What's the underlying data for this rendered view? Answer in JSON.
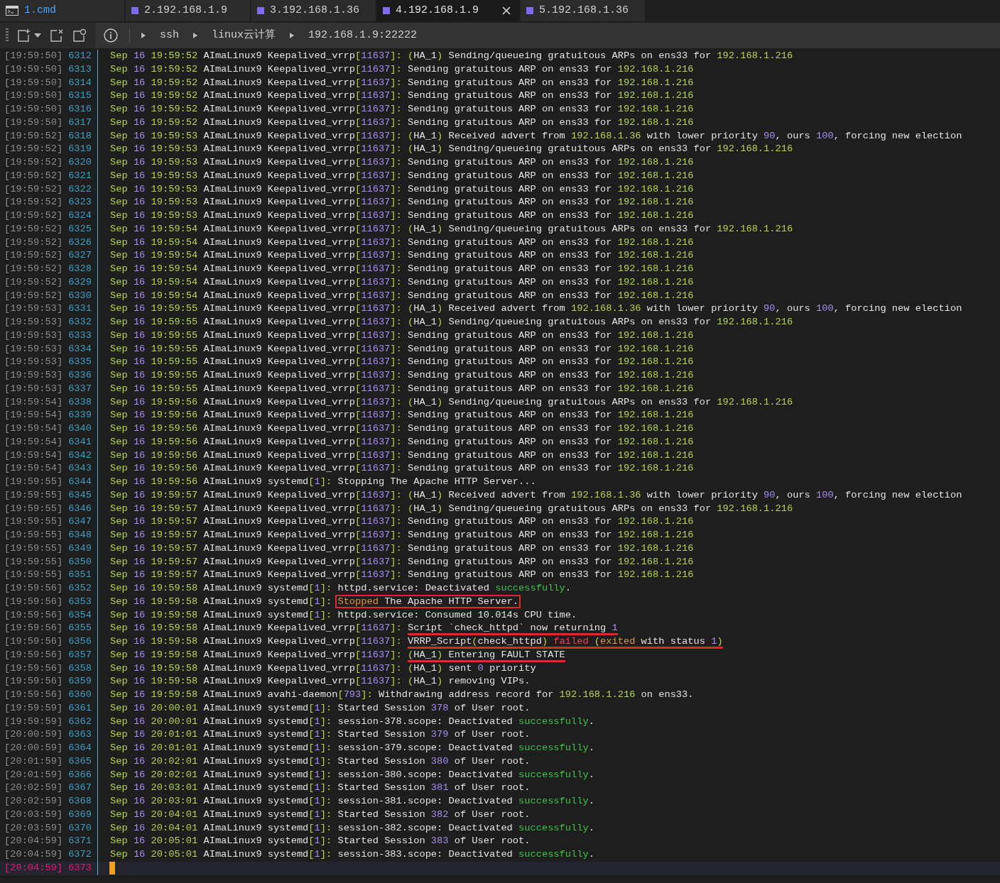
{
  "tabs": [
    {
      "label": "1.cmd",
      "kind": "cmd",
      "selected": false
    },
    {
      "label": "2.192.168.1.9",
      "kind": "ssh",
      "selected": false
    },
    {
      "label": "3.192.168.1.36",
      "kind": "ssh",
      "selected": false
    },
    {
      "label": "4.192.168.1.9",
      "kind": "ssh",
      "selected": true
    },
    {
      "label": "5.192.168.1.36",
      "kind": "ssh",
      "selected": false
    }
  ],
  "breadcrumb": [
    "ssh",
    "linux云计算",
    "192.168.1.9:22222"
  ],
  "lines": [
    {
      "time": "[19:59:50]",
      "num": "6312",
      "kind": "log",
      "month": "Sep",
      "day": "16",
      "clock": "19:59:52",
      "host": "AImaLinux9",
      "proc": "Keepalived_vrrp",
      "pid": "[11637]:",
      "msg": [
        {
          "text": "(",
          "kind": "accent"
        },
        {
          "text": "HA_1",
          "kind": "plain"
        },
        {
          "text": ")",
          "kind": "accent"
        },
        {
          "text": " Sending/queueing gratuitous ARPs on ens33 for ",
          "kind": "plain"
        },
        {
          "text": "192.168.1.216",
          "kind": "accent"
        }
      ]
    },
    {
      "time": "[19:59:50]",
      "num": "6313",
      "kind": "log",
      "month": "Sep",
      "day": "16",
      "clock": "19:59:52",
      "host": "AImaLinux9",
      "proc": "Keepalived_vrrp",
      "pid": "[11637]:",
      "msg": [
        {
          "text": "Sending gratuitous ARP on ens33 for ",
          "kind": "plain"
        },
        {
          "text": "192.168.1.216",
          "kind": "accent"
        }
      ]
    },
    {
      "time": "[19:59:50]",
      "num": "6314",
      "kind": "log",
      "month": "Sep",
      "day": "16",
      "clock": "19:59:52",
      "host": "AImaLinux9",
      "proc": "Keepalived_vrrp",
      "pid": "[11637]:",
      "msg": [
        {
          "text": "Sending gratuitous ARP on ens33 for ",
          "kind": "plain"
        },
        {
          "text": "192.168.1.216",
          "kind": "accent"
        }
      ]
    },
    {
      "time": "[19:59:50]",
      "num": "6315",
      "kind": "log",
      "month": "Sep",
      "day": "16",
      "clock": "19:59:52",
      "host": "AImaLinux9",
      "proc": "Keepalived_vrrp",
      "pid": "[11637]:",
      "msg": [
        {
          "text": "Sending gratuitous ARP on ens33 for ",
          "kind": "plain"
        },
        {
          "text": "192.168.1.216",
          "kind": "accent"
        }
      ]
    },
    {
      "time": "[19:59:50]",
      "num": "6316",
      "kind": "log",
      "month": "Sep",
      "day": "16",
      "clock": "19:59:52",
      "host": "AImaLinux9",
      "proc": "Keepalived_vrrp",
      "pid": "[11637]:",
      "msg": [
        {
          "text": "Sending gratuitous ARP on ens33 for ",
          "kind": "plain"
        },
        {
          "text": "192.168.1.216",
          "kind": "accent"
        }
      ]
    },
    {
      "time": "[19:59:50]",
      "num": "6317",
      "kind": "log",
      "month": "Sep",
      "day": "16",
      "clock": "19:59:52",
      "host": "AImaLinux9",
      "proc": "Keepalived_vrrp",
      "pid": "[11637]:",
      "msg": [
        {
          "text": "Sending gratuitous ARP on ens33 for ",
          "kind": "plain"
        },
        {
          "text": "192.168.1.216",
          "kind": "accent"
        }
      ]
    },
    {
      "time": "[19:59:52]",
      "num": "6318",
      "kind": "log",
      "month": "Sep",
      "day": "16",
      "clock": "19:59:53",
      "host": "AImaLinux9",
      "proc": "Keepalived_vrrp",
      "pid": "[11637]:",
      "msg": [
        {
          "text": "(",
          "kind": "accent"
        },
        {
          "text": "HA_1",
          "kind": "plain"
        },
        {
          "text": ")",
          "kind": "accent"
        },
        {
          "text": " Received advert from ",
          "kind": "plain"
        },
        {
          "text": "192.168.1.36",
          "kind": "accent"
        },
        {
          "text": " with lower priority ",
          "kind": "plain"
        },
        {
          "text": "90",
          "kind": "number"
        },
        {
          "text": ", ours ",
          "kind": "plain"
        },
        {
          "text": "100",
          "kind": "number"
        },
        {
          "text": ", forcing new election",
          "kind": "plain"
        }
      ]
    },
    {
      "time": "[19:59:52]",
      "num": "6319",
      "kind": "log",
      "month": "Sep",
      "day": "16",
      "clock": "19:59:53",
      "host": "AImaLinux9",
      "proc": "Keepalived_vrrp",
      "pid": "[11637]:",
      "msg": [
        {
          "text": "(",
          "kind": "accent"
        },
        {
          "text": "HA_1",
          "kind": "plain"
        },
        {
          "text": ")",
          "kind": "accent"
        },
        {
          "text": " Sending/queueing gratuitous ARPs on ens33 for ",
          "kind": "plain"
        },
        {
          "text": "192.168.1.216",
          "kind": "accent"
        }
      ]
    },
    {
      "time": "[19:59:52]",
      "num": "6320",
      "kind": "log",
      "month": "Sep",
      "day": "16",
      "clock": "19:59:53",
      "host": "AImaLinux9",
      "proc": "Keepalived_vrrp",
      "pid": "[11637]:",
      "msg": [
        {
          "text": "Sending gratuitous ARP on ens33 for ",
          "kind": "plain"
        },
        {
          "text": "192.168.1.216",
          "kind": "accent"
        }
      ]
    },
    {
      "time": "[19:59:52]",
      "num": "6321",
      "kind": "log",
      "month": "Sep",
      "day": "16",
      "clock": "19:59:53",
      "host": "AImaLinux9",
      "proc": "Keepalived_vrrp",
      "pid": "[11637]:",
      "msg": [
        {
          "text": "Sending gratuitous ARP on ens33 for ",
          "kind": "plain"
        },
        {
          "text": "192.168.1.216",
          "kind": "accent"
        }
      ]
    },
    {
      "time": "[19:59:52]",
      "num": "6322",
      "kind": "log",
      "month": "Sep",
      "day": "16",
      "clock": "19:59:53",
      "host": "AImaLinux9",
      "proc": "Keepalived_vrrp",
      "pid": "[11637]:",
      "msg": [
        {
          "text": "Sending gratuitous ARP on ens33 for ",
          "kind": "plain"
        },
        {
          "text": "192.168.1.216",
          "kind": "accent"
        }
      ]
    },
    {
      "time": "[19:59:52]",
      "num": "6323",
      "kind": "log",
      "month": "Sep",
      "day": "16",
      "clock": "19:59:53",
      "host": "AImaLinux9",
      "proc": "Keepalived_vrrp",
      "pid": "[11637]:",
      "msg": [
        {
          "text": "Sending gratuitous ARP on ens33 for ",
          "kind": "plain"
        },
        {
          "text": "192.168.1.216",
          "kind": "accent"
        }
      ]
    },
    {
      "time": "[19:59:52]",
      "num": "6324",
      "kind": "log",
      "month": "Sep",
      "day": "16",
      "clock": "19:59:53",
      "host": "AImaLinux9",
      "proc": "Keepalived_vrrp",
      "pid": "[11637]:",
      "msg": [
        {
          "text": "Sending gratuitous ARP on ens33 for ",
          "kind": "plain"
        },
        {
          "text": "192.168.1.216",
          "kind": "accent"
        }
      ]
    },
    {
      "time": "[19:59:52]",
      "num": "6325",
      "kind": "log",
      "month": "Sep",
      "day": "16",
      "clock": "19:59:54",
      "host": "AImaLinux9",
      "proc": "Keepalived_vrrp",
      "pid": "[11637]:",
      "msg": [
        {
          "text": "(",
          "kind": "accent"
        },
        {
          "text": "HA_1",
          "kind": "plain"
        },
        {
          "text": ")",
          "kind": "accent"
        },
        {
          "text": " Sending/queueing gratuitous ARPs on ens33 for ",
          "kind": "plain"
        },
        {
          "text": "192.168.1.216",
          "kind": "accent"
        }
      ]
    },
    {
      "time": "[19:59:52]",
      "num": "6326",
      "kind": "log",
      "month": "Sep",
      "day": "16",
      "clock": "19:59:54",
      "host": "AImaLinux9",
      "proc": "Keepalived_vrrp",
      "pid": "[11637]:",
      "msg": [
        {
          "text": "Sending gratuitous ARP on ens33 for ",
          "kind": "plain"
        },
        {
          "text": "192.168.1.216",
          "kind": "accent"
        }
      ]
    },
    {
      "time": "[19:59:52]",
      "num": "6327",
      "kind": "log",
      "month": "Sep",
      "day": "16",
      "clock": "19:59:54",
      "host": "AImaLinux9",
      "proc": "Keepalived_vrrp",
      "pid": "[11637]:",
      "msg": [
        {
          "text": "Sending gratuitous ARP on ens33 for ",
          "kind": "plain"
        },
        {
          "text": "192.168.1.216",
          "kind": "accent"
        }
      ]
    },
    {
      "time": "[19:59:52]",
      "num": "6328",
      "kind": "log",
      "month": "Sep",
      "day": "16",
      "clock": "19:59:54",
      "host": "AImaLinux9",
      "proc": "Keepalived_vrrp",
      "pid": "[11637]:",
      "msg": [
        {
          "text": "Sending gratuitous ARP on ens33 for ",
          "kind": "plain"
        },
        {
          "text": "192.168.1.216",
          "kind": "accent"
        }
      ]
    },
    {
      "time": "[19:59:52]",
      "num": "6329",
      "kind": "log",
      "month": "Sep",
      "day": "16",
      "clock": "19:59:54",
      "host": "AImaLinux9",
      "proc": "Keepalived_vrrp",
      "pid": "[11637]:",
      "msg": [
        {
          "text": "Sending gratuitous ARP on ens33 for ",
          "kind": "plain"
        },
        {
          "text": "192.168.1.216",
          "kind": "accent"
        }
      ]
    },
    {
      "time": "[19:59:52]",
      "num": "6330",
      "kind": "log",
      "month": "Sep",
      "day": "16",
      "clock": "19:59:54",
      "host": "AImaLinux9",
      "proc": "Keepalived_vrrp",
      "pid": "[11637]:",
      "msg": [
        {
          "text": "Sending gratuitous ARP on ens33 for ",
          "kind": "plain"
        },
        {
          "text": "192.168.1.216",
          "kind": "accent"
        }
      ]
    },
    {
      "time": "[19:59:53]",
      "num": "6331",
      "kind": "log",
      "month": "Sep",
      "day": "16",
      "clock": "19:59:55",
      "host": "AImaLinux9",
      "proc": "Keepalived_vrrp",
      "pid": "[11637]:",
      "msg": [
        {
          "text": "(",
          "kind": "accent"
        },
        {
          "text": "HA_1",
          "kind": "plain"
        },
        {
          "text": ")",
          "kind": "accent"
        },
        {
          "text": " Received advert from ",
          "kind": "plain"
        },
        {
          "text": "192.168.1.36",
          "kind": "accent"
        },
        {
          "text": " with lower priority ",
          "kind": "plain"
        },
        {
          "text": "90",
          "kind": "number"
        },
        {
          "text": ", ours ",
          "kind": "plain"
        },
        {
          "text": "100",
          "kind": "number"
        },
        {
          "text": ", forcing new election",
          "kind": "plain"
        }
      ]
    },
    {
      "time": "[19:59:53]",
      "num": "6332",
      "kind": "log",
      "month": "Sep",
      "day": "16",
      "clock": "19:59:55",
      "host": "AImaLinux9",
      "proc": "Keepalived_vrrp",
      "pid": "[11637]:",
      "msg": [
        {
          "text": "(",
          "kind": "accent"
        },
        {
          "text": "HA_1",
          "kind": "plain"
        },
        {
          "text": ")",
          "kind": "accent"
        },
        {
          "text": " Sending/queueing gratuitous ARPs on ens33 for ",
          "kind": "plain"
        },
        {
          "text": "192.168.1.216",
          "kind": "accent"
        }
      ]
    },
    {
      "time": "[19:59:53]",
      "num": "6333",
      "kind": "log",
      "month": "Sep",
      "day": "16",
      "clock": "19:59:55",
      "host": "AImaLinux9",
      "proc": "Keepalived_vrrp",
      "pid": "[11637]:",
      "msg": [
        {
          "text": "Sending gratuitous ARP on ens33 for ",
          "kind": "plain"
        },
        {
          "text": "192.168.1.216",
          "kind": "accent"
        }
      ]
    },
    {
      "time": "[19:59:53]",
      "num": "6334",
      "kind": "log",
      "month": "Sep",
      "day": "16",
      "clock": "19:59:55",
      "host": "AImaLinux9",
      "proc": "Keepalived_vrrp",
      "pid": "[11637]:",
      "msg": [
        {
          "text": "Sending gratuitous ARP on ens33 for ",
          "kind": "plain"
        },
        {
          "text": "192.168.1.216",
          "kind": "accent"
        }
      ]
    },
    {
      "time": "[19:59:53]",
      "num": "6335",
      "kind": "log",
      "month": "Sep",
      "day": "16",
      "clock": "19:59:55",
      "host": "AImaLinux9",
      "proc": "Keepalived_vrrp",
      "pid": "[11637]:",
      "msg": [
        {
          "text": "Sending gratuitous ARP on ens33 for ",
          "kind": "plain"
        },
        {
          "text": "192.168.1.216",
          "kind": "accent"
        }
      ]
    },
    {
      "time": "[19:59:53]",
      "num": "6336",
      "kind": "log",
      "month": "Sep",
      "day": "16",
      "clock": "19:59:55",
      "host": "AImaLinux9",
      "proc": "Keepalived_vrrp",
      "pid": "[11637]:",
      "msg": [
        {
          "text": "Sending gratuitous ARP on ens33 for ",
          "kind": "plain"
        },
        {
          "text": "192.168.1.216",
          "kind": "accent"
        }
      ]
    },
    {
      "time": "[19:59:53]",
      "num": "6337",
      "kind": "log",
      "month": "Sep",
      "day": "16",
      "clock": "19:59:55",
      "host": "AImaLinux9",
      "proc": "Keepalived_vrrp",
      "pid": "[11637]:",
      "msg": [
        {
          "text": "Sending gratuitous ARP on ens33 for ",
          "kind": "plain"
        },
        {
          "text": "192.168.1.216",
          "kind": "accent"
        }
      ]
    },
    {
      "time": "[19:59:54]",
      "num": "6338",
      "kind": "log",
      "month": "Sep",
      "day": "16",
      "clock": "19:59:56",
      "host": "AImaLinux9",
      "proc": "Keepalived_vrrp",
      "pid": "[11637]:",
      "msg": [
        {
          "text": "(",
          "kind": "accent"
        },
        {
          "text": "HA_1",
          "kind": "plain"
        },
        {
          "text": ")",
          "kind": "accent"
        },
        {
          "text": " Sending/queueing gratuitous ARPs on ens33 for ",
          "kind": "plain"
        },
        {
          "text": "192.168.1.216",
          "kind": "accent"
        }
      ]
    },
    {
      "time": "[19:59:54]",
      "num": "6339",
      "kind": "log",
      "month": "Sep",
      "day": "16",
      "clock": "19:59:56",
      "host": "AImaLinux9",
      "proc": "Keepalived_vrrp",
      "pid": "[11637]:",
      "msg": [
        {
          "text": "Sending gratuitous ARP on ens33 for ",
          "kind": "plain"
        },
        {
          "text": "192.168.1.216",
          "kind": "accent"
        }
      ]
    },
    {
      "time": "[19:59:54]",
      "num": "6340",
      "kind": "log",
      "month": "Sep",
      "day": "16",
      "clock": "19:59:56",
      "host": "AImaLinux9",
      "proc": "Keepalived_vrrp",
      "pid": "[11637]:",
      "msg": [
        {
          "text": "Sending gratuitous ARP on ens33 for ",
          "kind": "plain"
        },
        {
          "text": "192.168.1.216",
          "kind": "accent"
        }
      ]
    },
    {
      "time": "[19:59:54]",
      "num": "6341",
      "kind": "log",
      "month": "Sep",
      "day": "16",
      "clock": "19:59:56",
      "host": "AImaLinux9",
      "proc": "Keepalived_vrrp",
      "pid": "[11637]:",
      "msg": [
        {
          "text": "Sending gratuitous ARP on ens33 for ",
          "kind": "plain"
        },
        {
          "text": "192.168.1.216",
          "kind": "accent"
        }
      ]
    },
    {
      "time": "[19:59:54]",
      "num": "6342",
      "kind": "log",
      "month": "Sep",
      "day": "16",
      "clock": "19:59:56",
      "host": "AImaLinux9",
      "proc": "Keepalived_vrrp",
      "pid": "[11637]:",
      "msg": [
        {
          "text": "Sending gratuitous ARP on ens33 for ",
          "kind": "plain"
        },
        {
          "text": "192.168.1.216",
          "kind": "accent"
        }
      ]
    },
    {
      "time": "[19:59:54]",
      "num": "6343",
      "kind": "log",
      "month": "Sep",
      "day": "16",
      "clock": "19:59:56",
      "host": "AImaLinux9",
      "proc": "Keepalived_vrrp",
      "pid": "[11637]:",
      "msg": [
        {
          "text": "Sending gratuitous ARP on ens33 for ",
          "kind": "plain"
        },
        {
          "text": "192.168.1.216",
          "kind": "accent"
        }
      ]
    },
    {
      "time": "[19:59:55]",
      "num": "6344",
      "kind": "log",
      "month": "Sep",
      "day": "16",
      "clock": "19:59:56",
      "host": "AImaLinux9",
      "proc": "systemd",
      "pid": "[1]:",
      "msg": [
        {
          "text": "Stopping The Apache HTTP Server...",
          "kind": "plain"
        }
      ]
    },
    {
      "time": "[19:59:55]",
      "num": "6345",
      "kind": "log",
      "month": "Sep",
      "day": "16",
      "clock": "19:59:57",
      "host": "AImaLinux9",
      "proc": "Keepalived_vrrp",
      "pid": "[11637]:",
      "msg": [
        {
          "text": "(",
          "kind": "accent"
        },
        {
          "text": "HA_1",
          "kind": "plain"
        },
        {
          "text": ")",
          "kind": "accent"
        },
        {
          "text": " Received advert from ",
          "kind": "plain"
        },
        {
          "text": "192.168.1.36",
          "kind": "accent"
        },
        {
          "text": " with lower priority ",
          "kind": "plain"
        },
        {
          "text": "90",
          "kind": "number"
        },
        {
          "text": ", ours ",
          "kind": "plain"
        },
        {
          "text": "100",
          "kind": "number"
        },
        {
          "text": ", forcing new election",
          "kind": "plain"
        }
      ]
    },
    {
      "time": "[19:59:55]",
      "num": "6346",
      "kind": "log",
      "month": "Sep",
      "day": "16",
      "clock": "19:59:57",
      "host": "AImaLinux9",
      "proc": "Keepalived_vrrp",
      "pid": "[11637]:",
      "msg": [
        {
          "text": "(",
          "kind": "accent"
        },
        {
          "text": "HA_1",
          "kind": "plain"
        },
        {
          "text": ")",
          "kind": "accent"
        },
        {
          "text": " Sending/queueing gratuitous ARPs on ens33 for ",
          "kind": "plain"
        },
        {
          "text": "192.168.1.216",
          "kind": "accent"
        }
      ]
    },
    {
      "time": "[19:59:55]",
      "num": "6347",
      "kind": "log",
      "month": "Sep",
      "day": "16",
      "clock": "19:59:57",
      "host": "AImaLinux9",
      "proc": "Keepalived_vrrp",
      "pid": "[11637]:",
      "msg": [
        {
          "text": "Sending gratuitous ARP on ens33 for ",
          "kind": "plain"
        },
        {
          "text": "192.168.1.216",
          "kind": "accent"
        }
      ]
    },
    {
      "time": "[19:59:55]",
      "num": "6348",
      "kind": "log",
      "month": "Sep",
      "day": "16",
      "clock": "19:59:57",
      "host": "AImaLinux9",
      "proc": "Keepalived_vrrp",
      "pid": "[11637]:",
      "msg": [
        {
          "text": "Sending gratuitous ARP on ens33 for ",
          "kind": "plain"
        },
        {
          "text": "192.168.1.216",
          "kind": "accent"
        }
      ]
    },
    {
      "time": "[19:59:55]",
      "num": "6349",
      "kind": "log",
      "month": "Sep",
      "day": "16",
      "clock": "19:59:57",
      "host": "AImaLinux9",
      "proc": "Keepalived_vrrp",
      "pid": "[11637]:",
      "msg": [
        {
          "text": "Sending gratuitous ARP on ens33 for ",
          "kind": "plain"
        },
        {
          "text": "192.168.1.216",
          "kind": "accent"
        }
      ]
    },
    {
      "time": "[19:59:55]",
      "num": "6350",
      "kind": "log",
      "month": "Sep",
      "day": "16",
      "clock": "19:59:57",
      "host": "AImaLinux9",
      "proc": "Keepalived_vrrp",
      "pid": "[11637]:",
      "msg": [
        {
          "text": "Sending gratuitous ARP on ens33 for ",
          "kind": "plain"
        },
        {
          "text": "192.168.1.216",
          "kind": "accent"
        }
      ]
    },
    {
      "time": "[19:59:55]",
      "num": "6351",
      "kind": "log",
      "month": "Sep",
      "day": "16",
      "clock": "19:59:57",
      "host": "AImaLinux9",
      "proc": "Keepalived_vrrp",
      "pid": "[11637]:",
      "msg": [
        {
          "text": "Sending gratuitous ARP on ens33 for ",
          "kind": "plain"
        },
        {
          "text": "192.168.1.216",
          "kind": "accent"
        }
      ]
    },
    {
      "time": "[19:59:56]",
      "num": "6352",
      "kind": "log",
      "month": "Sep",
      "day": "16",
      "clock": "19:59:58",
      "host": "AImaLinux9",
      "proc": "systemd",
      "pid": "[1]:",
      "msg": [
        {
          "text": "httpd.service: Deactivated ",
          "kind": "plain"
        },
        {
          "text": "successfully",
          "kind": "success"
        },
        {
          "text": ".",
          "kind": "plain"
        }
      ]
    },
    {
      "time": "[19:59:56]",
      "num": "6353",
      "kind": "log",
      "month": "Sep",
      "day": "16",
      "clock": "19:59:58",
      "host": "AImaLinux9",
      "proc": "systemd",
      "pid": "[1]:",
      "boxed": true,
      "msg": [
        {
          "text": "Stopped",
          "kind": "warning"
        },
        {
          "text": " The Apache HTTP Server.",
          "kind": "plain"
        }
      ]
    },
    {
      "time": "[19:59:56]",
      "num": "6354",
      "kind": "log",
      "month": "Sep",
      "day": "16",
      "clock": "19:59:58",
      "host": "AImaLinux9",
      "proc": "systemd",
      "pid": "[1]:",
      "msg": [
        {
          "text": "httpd.service: Consumed 10.014s CPU time.",
          "kind": "plain"
        }
      ]
    },
    {
      "time": "[19:59:56]",
      "num": "6355",
      "kind": "log",
      "month": "Sep",
      "day": "16",
      "clock": "19:59:58",
      "host": "AImaLinux9",
      "proc": "Keepalived_vrrp",
      "pid": "[11637]:",
      "underlined": true,
      "msg": [
        {
          "text": "Script `check_httpd` now returning ",
          "kind": "plain"
        },
        {
          "text": "1",
          "kind": "number"
        }
      ]
    },
    {
      "time": "[19:59:56]",
      "num": "6356",
      "kind": "log",
      "month": "Sep",
      "day": "16",
      "clock": "19:59:58",
      "host": "AImaLinux9",
      "proc": "Keepalived_vrrp",
      "pid": "[11637]:",
      "underlined": true,
      "msg": [
        {
          "text": "VRRP_Script",
          "kind": "plain"
        },
        {
          "text": "(",
          "kind": "accent"
        },
        {
          "text": "check_httpd",
          "kind": "plain"
        },
        {
          "text": ")",
          "kind": "accent"
        },
        {
          "text": " failed",
          "kind": "error"
        },
        {
          "text": " (",
          "kind": "accent"
        },
        {
          "text": "exited",
          "kind": "warning"
        },
        {
          "text": " with status ",
          "kind": "plain"
        },
        {
          "text": "1",
          "kind": "number"
        },
        {
          "text": ")",
          "kind": "accent"
        }
      ]
    },
    {
      "time": "[19:59:56]",
      "num": "6357",
      "kind": "log",
      "month": "Sep",
      "day": "16",
      "clock": "19:59:58",
      "host": "AImaLinux9",
      "proc": "Keepalived_vrrp",
      "pid": "[11637]:",
      "underlined": true,
      "msg": [
        {
          "text": "(",
          "kind": "accent"
        },
        {
          "text": "HA_1",
          "kind": "plain"
        },
        {
          "text": ")",
          "kind": "accent"
        },
        {
          "text": " Entering FAULT STATE",
          "kind": "plain"
        }
      ]
    },
    {
      "time": "[19:59:56]",
      "num": "6358",
      "kind": "log",
      "month": "Sep",
      "day": "16",
      "clock": "19:59:58",
      "host": "AImaLinux9",
      "proc": "Keepalived_vrrp",
      "pid": "[11637]:",
      "msg": [
        {
          "text": "(",
          "kind": "accent"
        },
        {
          "text": "HA_1",
          "kind": "plain"
        },
        {
          "text": ")",
          "kind": "accent"
        },
        {
          "text": " sent ",
          "kind": "plain"
        },
        {
          "text": "0",
          "kind": "number"
        },
        {
          "text": " priority",
          "kind": "plain"
        }
      ]
    },
    {
      "time": "[19:59:56]",
      "num": "6359",
      "kind": "log",
      "month": "Sep",
      "day": "16",
      "clock": "19:59:58",
      "host": "AImaLinux9",
      "proc": "Keepalived_vrrp",
      "pid": "[11637]:",
      "msg": [
        {
          "text": "(",
          "kind": "accent"
        },
        {
          "text": "HA_1",
          "kind": "plain"
        },
        {
          "text": ")",
          "kind": "accent"
        },
        {
          "text": " removing VIPs.",
          "kind": "plain"
        }
      ]
    },
    {
      "time": "[19:59:56]",
      "num": "6360",
      "kind": "log",
      "month": "Sep",
      "day": "16",
      "clock": "19:59:58",
      "host": "AImaLinux9",
      "proc": "avahi-daemon",
      "pid": "[793]:",
      "msg": [
        {
          "text": "Withdrawing address record for ",
          "kind": "plain"
        },
        {
          "text": "192.168.1.216",
          "kind": "accent"
        },
        {
          "text": " on ens33.",
          "kind": "plain"
        }
      ]
    },
    {
      "time": "[19:59:59]",
      "num": "6361",
      "kind": "log",
      "month": "Sep",
      "day": "16",
      "clock": "20:00:01",
      "host": "AImaLinux9",
      "proc": "systemd",
      "pid": "[1]:",
      "msg": [
        {
          "text": "Started Session ",
          "kind": "plain"
        },
        {
          "text": "378",
          "kind": "number"
        },
        {
          "text": " of User root.",
          "kind": "plain"
        }
      ]
    },
    {
      "time": "[19:59:59]",
      "num": "6362",
      "kind": "log",
      "month": "Sep",
      "day": "16",
      "clock": "20:00:01",
      "host": "AImaLinux9",
      "proc": "systemd",
      "pid": "[1]:",
      "msg": [
        {
          "text": "session-378.scope: Deactivated ",
          "kind": "plain"
        },
        {
          "text": "successfully",
          "kind": "success"
        },
        {
          "text": ".",
          "kind": "plain"
        }
      ]
    },
    {
      "time": "[20:00:59]",
      "num": "6363",
      "kind": "log",
      "month": "Sep",
      "day": "16",
      "clock": "20:01:01",
      "host": "AImaLinux9",
      "proc": "systemd",
      "pid": "[1]:",
      "msg": [
        {
          "text": "Started Session ",
          "kind": "plain"
        },
        {
          "text": "379",
          "kind": "number"
        },
        {
          "text": " of User root.",
          "kind": "plain"
        }
      ]
    },
    {
      "time": "[20:00:59]",
      "num": "6364",
      "kind": "log",
      "month": "Sep",
      "day": "16",
      "clock": "20:01:01",
      "host": "AImaLinux9",
      "proc": "systemd",
      "pid": "[1]:",
      "msg": [
        {
          "text": "session-379.scope: Deactivated ",
          "kind": "plain"
        },
        {
          "text": "successfully",
          "kind": "success"
        },
        {
          "text": ".",
          "kind": "plain"
        }
      ]
    },
    {
      "time": "[20:01:59]",
      "num": "6365",
      "kind": "log",
      "month": "Sep",
      "day": "16",
      "clock": "20:02:01",
      "host": "AImaLinux9",
      "proc": "systemd",
      "pid": "[1]:",
      "msg": [
        {
          "text": "Started Session ",
          "kind": "plain"
        },
        {
          "text": "380",
          "kind": "number"
        },
        {
          "text": " of User root.",
          "kind": "plain"
        }
      ]
    },
    {
      "time": "[20:01:59]",
      "num": "6366",
      "kind": "log",
      "month": "Sep",
      "day": "16",
      "clock": "20:02:01",
      "host": "AImaLinux9",
      "proc": "systemd",
      "pid": "[1]:",
      "msg": [
        {
          "text": "session-380.scope: Deactivated ",
          "kind": "plain"
        },
        {
          "text": "successfully",
          "kind": "success"
        },
        {
          "text": ".",
          "kind": "plain"
        }
      ]
    },
    {
      "time": "[20:02:59]",
      "num": "6367",
      "kind": "log",
      "month": "Sep",
      "day": "16",
      "clock": "20:03:01",
      "host": "AImaLinux9",
      "proc": "systemd",
      "pid": "[1]:",
      "msg": [
        {
          "text": "Started Session ",
          "kind": "plain"
        },
        {
          "text": "381",
          "kind": "number"
        },
        {
          "text": " of User root.",
          "kind": "plain"
        }
      ]
    },
    {
      "time": "[20:02:59]",
      "num": "6368",
      "kind": "log",
      "month": "Sep",
      "day": "16",
      "clock": "20:03:01",
      "host": "AImaLinux9",
      "proc": "systemd",
      "pid": "[1]:",
      "msg": [
        {
          "text": "session-381.scope: Deactivated ",
          "kind": "plain"
        },
        {
          "text": "successfully",
          "kind": "success"
        },
        {
          "text": ".",
          "kind": "plain"
        }
      ]
    },
    {
      "time": "[20:03:59]",
      "num": "6369",
      "kind": "log",
      "month": "Sep",
      "day": "16",
      "clock": "20:04:01",
      "host": "AImaLinux9",
      "proc": "systemd",
      "pid": "[1]:",
      "msg": [
        {
          "text": "Started Session ",
          "kind": "plain"
        },
        {
          "text": "382",
          "kind": "number"
        },
        {
          "text": " of User root.",
          "kind": "plain"
        }
      ]
    },
    {
      "time": "[20:03:59]",
      "num": "6370",
      "kind": "log",
      "month": "Sep",
      "day": "16",
      "clock": "20:04:01",
      "host": "AImaLinux9",
      "proc": "systemd",
      "pid": "[1]:",
      "msg": [
        {
          "text": "session-382.scope: Deactivated ",
          "kind": "plain"
        },
        {
          "text": "successfully",
          "kind": "success"
        },
        {
          "text": ".",
          "kind": "plain"
        }
      ]
    },
    {
      "time": "[20:04:59]",
      "num": "6371",
      "kind": "log",
      "month": "Sep",
      "day": "16",
      "clock": "20:05:01",
      "host": "AImaLinux9",
      "proc": "systemd",
      "pid": "[1]:",
      "msg": [
        {
          "text": "Started Session ",
          "kind": "plain"
        },
        {
          "text": "383",
          "kind": "number"
        },
        {
          "text": " of User root.",
          "kind": "plain"
        }
      ]
    },
    {
      "time": "[20:04:59]",
      "num": "6372",
      "kind": "log",
      "month": "Sep",
      "day": "16",
      "clock": "20:05:01",
      "host": "AImaLinux9",
      "proc": "systemd",
      "pid": "[1]:",
      "msg": [
        {
          "text": "session-383.scope: Deactivated ",
          "kind": "plain"
        },
        {
          "text": "successfully",
          "kind": "success"
        },
        {
          "text": ".",
          "kind": "plain"
        }
      ]
    },
    {
      "time": "[20:04:59]",
      "num": "6373",
      "kind": "prompt"
    }
  ]
}
